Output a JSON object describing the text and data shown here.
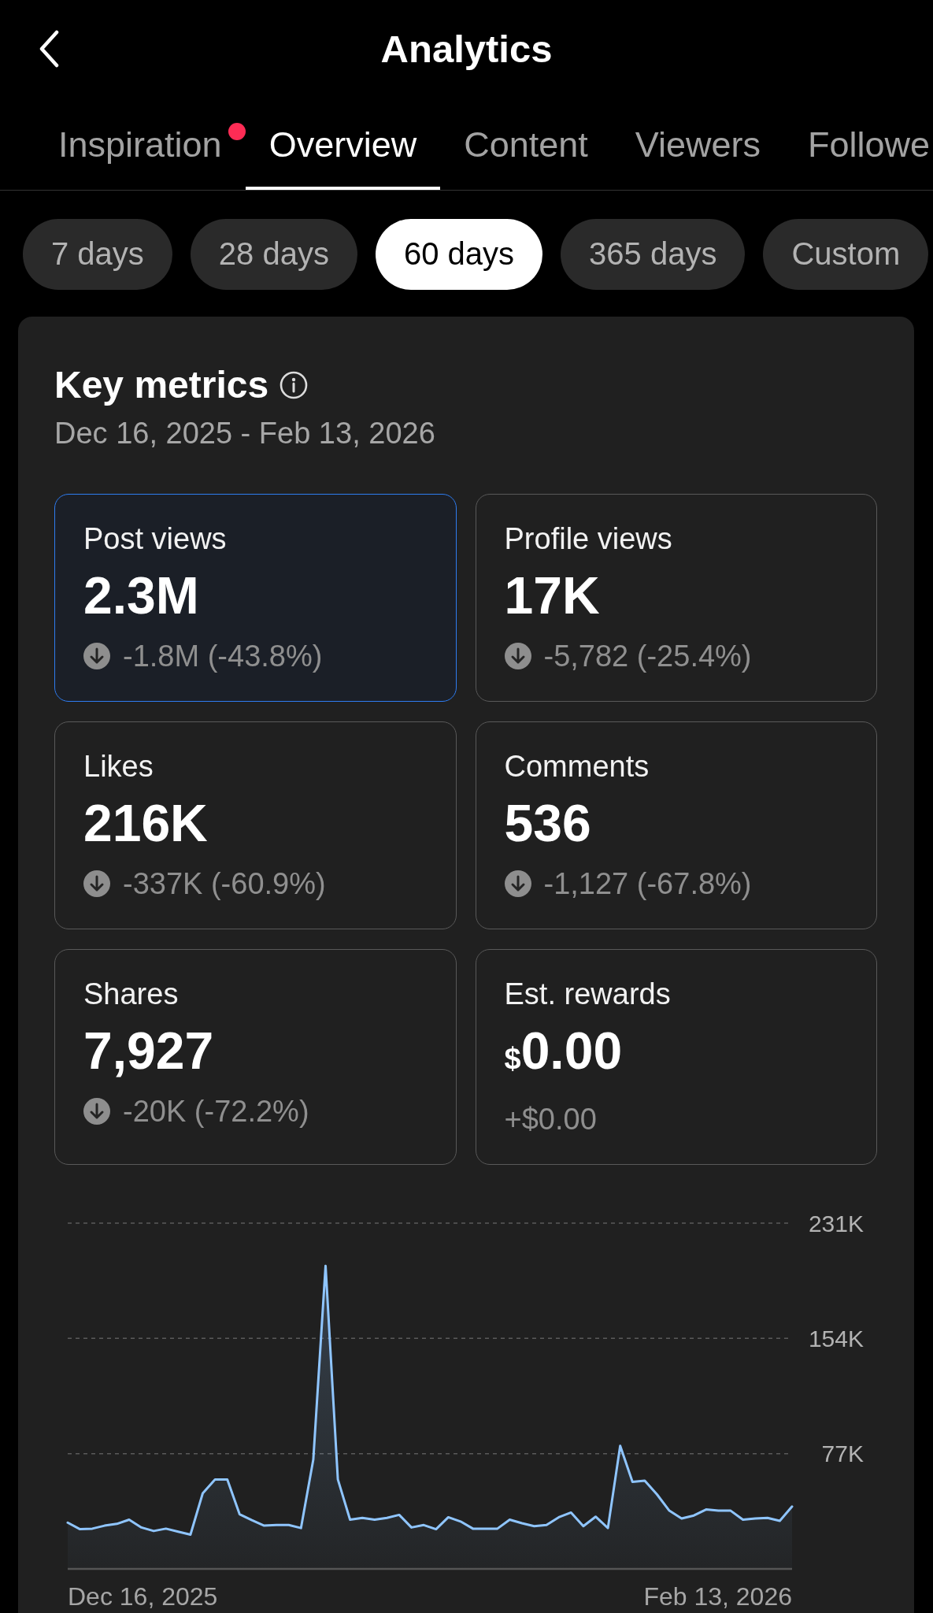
{
  "header": {
    "title": "Analytics"
  },
  "tabs": [
    {
      "label": "Inspiration",
      "selected": false,
      "notification_dot": true
    },
    {
      "label": "Overview",
      "selected": true,
      "notification_dot": false
    },
    {
      "label": "Content",
      "selected": false,
      "notification_dot": false
    },
    {
      "label": "Viewers",
      "selected": false,
      "notification_dot": false
    },
    {
      "label": "Followe",
      "selected": false,
      "notification_dot": false
    }
  ],
  "ranges": [
    {
      "label": "7 days",
      "selected": false
    },
    {
      "label": "28 days",
      "selected": false
    },
    {
      "label": "60 days",
      "selected": true
    },
    {
      "label": "365 days",
      "selected": false
    },
    {
      "label": "Custom",
      "selected": false
    }
  ],
  "key_metrics": {
    "title": "Key metrics",
    "date_range": "Dec 16, 2025 - Feb 13, 2026",
    "metrics": [
      {
        "kind": "decline",
        "label": "Post views",
        "value": "2.3M",
        "change": "-1.8M (-43.8%)",
        "selected": true
      },
      {
        "kind": "decline",
        "label": "Profile views",
        "value": "17K",
        "change": "-5,782 (-25.4%)",
        "selected": false
      },
      {
        "kind": "decline",
        "label": "Likes",
        "value": "216K",
        "change": "-337K (-60.9%)",
        "selected": false
      },
      {
        "kind": "decline",
        "label": "Comments",
        "value": "536",
        "change": "-1,127 (-67.8%)",
        "selected": false
      },
      {
        "kind": "decline",
        "label": "Shares",
        "value": "7,927",
        "change": "-20K (-72.2%)",
        "selected": false
      },
      {
        "kind": "plain",
        "label": "Est. rewards",
        "currency": "$",
        "value": "0.00",
        "change": "+$0.00",
        "selected": false
      }
    ],
    "chart_data": {
      "type": "area",
      "categories": [
        null,
        null,
        null,
        null,
        null,
        null,
        null,
        null,
        null,
        null,
        null,
        null,
        null,
        null,
        null,
        null,
        null,
        null,
        null,
        null,
        null,
        null,
        null,
        null,
        null,
        null,
        null,
        null,
        null,
        null,
        null,
        null,
        null,
        null,
        null,
        null,
        null,
        null,
        null,
        null,
        null,
        null,
        null,
        null,
        null,
        null,
        null,
        null,
        null,
        null,
        null,
        null,
        null,
        null,
        null,
        null,
        null,
        null,
        null,
        null
      ],
      "series": [
        {
          "color": "#8fc5ff",
          "values": [
            30.9,
            26.5,
            26.9,
            28.9,
            30.1,
            32.9,
            27.7,
            25.3,
            26.9,
            24.9,
            22.9,
            50.5,
            59.8,
            59.8,
            36.5,
            32.5,
            28.9,
            29.3,
            29.3,
            27.3,
            73.0,
            202.5,
            59.8,
            32.9,
            34.1,
            32.9,
            34.1,
            36.1,
            27.7,
            29.3,
            26.5,
            34.5,
            31.7,
            26.9,
            26.9,
            26.9,
            32.9,
            30.5,
            28.5,
            29.3,
            34.5,
            37.7,
            28.5,
            34.9,
            27.3,
            82.2,
            58.1,
            59.0,
            49.7,
            38.9,
            33.7,
            35.7,
            39.7,
            38.9,
            38.9,
            32.9,
            33.7,
            34.1,
            32.1,
            41.7
          ]
        }
      ],
      "ylim": [
        0,
        231
      ],
      "yticks": [
        {
          "value": 77,
          "label": "77K"
        },
        {
          "value": 154,
          "label": "154K"
        },
        {
          "value": 231,
          "label": "231K"
        }
      ]
    },
    "chart_period": {
      "start": "Dec 16, 2025",
      "end": "Feb 13, 2026"
    }
  }
}
